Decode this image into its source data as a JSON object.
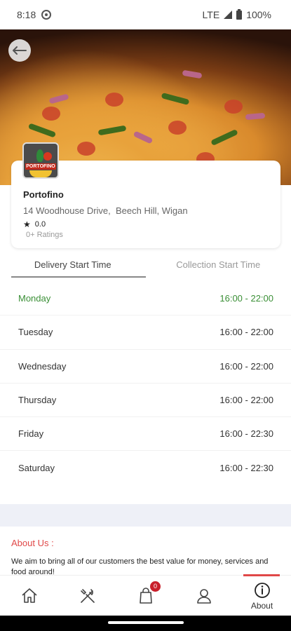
{
  "status_bar": {
    "time": "8:18",
    "network": "LTE",
    "battery": "100%"
  },
  "restaurant": {
    "name": "Portofino",
    "address": "14 Woodhouse Drive,  Beech Hill, Wigan",
    "rating": "0.0",
    "ratings_count": "0+ Ratings",
    "logo_text": "PORTOFINO"
  },
  "tabs": [
    {
      "label": "Delivery Start Time",
      "active": true
    },
    {
      "label": "Collection Start Time",
      "active": false
    }
  ],
  "schedule": [
    {
      "day": "Monday",
      "hours": "16:00 - 22:00",
      "today": true
    },
    {
      "day": "Tuesday",
      "hours": "16:00 - 22:00",
      "today": false
    },
    {
      "day": "Wednesday",
      "hours": "16:00 - 22:00",
      "today": false
    },
    {
      "day": "Thursday",
      "hours": "16:00 - 22:00",
      "today": false
    },
    {
      "day": "Friday",
      "hours": "16:00 - 22:30",
      "today": false
    },
    {
      "day": "Saturday",
      "hours": "16:00 - 22:30",
      "today": false
    }
  ],
  "about": {
    "title": "About Us :",
    "text": "We aim to bring all of our customers the best value for money, services and food around!"
  },
  "bottom_nav": {
    "items": [
      {
        "icon": "home-icon",
        "label": ""
      },
      {
        "icon": "cutlery-icon",
        "label": ""
      },
      {
        "icon": "cart-icon",
        "label": "",
        "badge": "0"
      },
      {
        "icon": "user-icon",
        "label": ""
      },
      {
        "icon": "info-icon",
        "label": "About"
      }
    ]
  },
  "colors": {
    "accent_red": "#e04848",
    "today_green": "#3a8f36",
    "badge_red": "#c91f2b"
  }
}
